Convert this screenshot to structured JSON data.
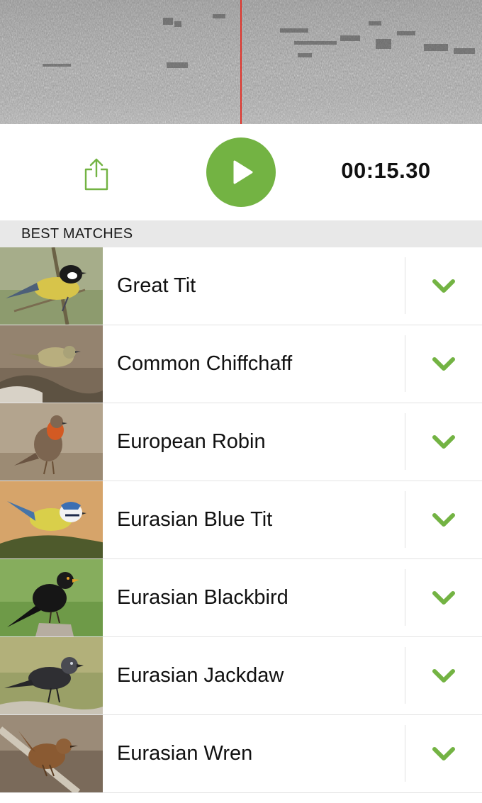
{
  "colors": {
    "accent": "#73b343",
    "playhead": "#e0332a",
    "section_bg": "#e8e8e8"
  },
  "player": {
    "share_icon": "share-icon",
    "play_icon": "play-icon",
    "time": "00:15.30"
  },
  "section": {
    "title": "BEST MATCHES"
  },
  "matches": [
    {
      "name": "Great Tit",
      "icon": "chevron-down-icon"
    },
    {
      "name": "Common Chiffchaff",
      "icon": "chevron-down-icon"
    },
    {
      "name": "European Robin",
      "icon": "chevron-down-icon"
    },
    {
      "name": "Eurasian Blue Tit",
      "icon": "chevron-down-icon"
    },
    {
      "name": "Eurasian Blackbird",
      "icon": "chevron-down-icon"
    },
    {
      "name": "Eurasian Jackdaw",
      "icon": "chevron-down-icon"
    },
    {
      "name": "Eurasian Wren",
      "icon": "chevron-down-icon"
    }
  ]
}
